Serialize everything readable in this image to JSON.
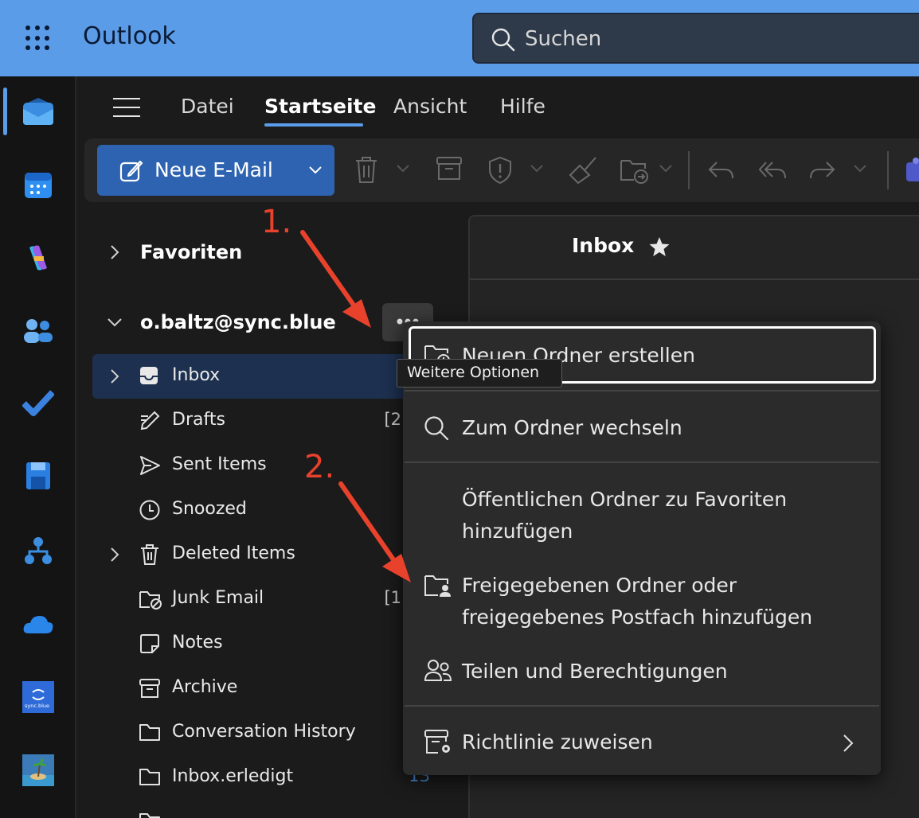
{
  "app": {
    "title": "Outlook"
  },
  "search": {
    "placeholder": "Suchen"
  },
  "tabs": [
    {
      "label": "Datei"
    },
    {
      "label": "Startseite"
    },
    {
      "label": "Ansicht"
    },
    {
      "label": "Hilfe"
    }
  ],
  "ribbon": {
    "new_mail_label": "Neue E-Mail"
  },
  "rail": {
    "items": [
      "mail-icon",
      "calendar-icon",
      "copilot-icon",
      "people-icon",
      "todo-icon",
      "app-icon",
      "org-icon",
      "onedrive-icon",
      "syncblue-icon",
      "app-island-icon"
    ],
    "syncblue_logo_text": "sync.blue"
  },
  "folders": {
    "favorites_label": "Favoriten",
    "account_label": "o.baltz@sync.blue",
    "items": [
      {
        "label": "Inbox",
        "count": ""
      },
      {
        "label": "Drafts",
        "count": "[2"
      },
      {
        "label": "Sent Items",
        "count": ""
      },
      {
        "label": "Snoozed",
        "count": ""
      },
      {
        "label": "Deleted Items",
        "count": ""
      },
      {
        "label": "Junk Email",
        "count": "[1"
      },
      {
        "label": "Notes",
        "count": ""
      },
      {
        "label": "Archive",
        "count": ""
      },
      {
        "label": "Conversation History",
        "count": ""
      },
      {
        "label": "Inbox.erledigt",
        "count": "13"
      }
    ]
  },
  "message_panel": {
    "title": "Inbox"
  },
  "tooltip": {
    "text": "Weitere Optionen"
  },
  "context_menu": {
    "items": [
      {
        "label": "Neuen Ordner erstellen"
      },
      {
        "label": "Zum Ordner wechseln"
      },
      {
        "label_line1": "Öffentlichen Ordner zu Favoriten",
        "label_line2": "hinzufügen"
      },
      {
        "label_line1": "Freigegebenen Ordner oder",
        "label_line2": "freigegebenes Postfach hinzufügen"
      },
      {
        "label": "Teilen und Berechtigungen"
      },
      {
        "label": "Richtlinie zuweisen"
      }
    ]
  },
  "annotations": {
    "step1": "1.",
    "step2": "2."
  },
  "colors": {
    "topbar": "#5b9ce9",
    "accent": "#2d63b0",
    "annotation": "#e8422c"
  }
}
